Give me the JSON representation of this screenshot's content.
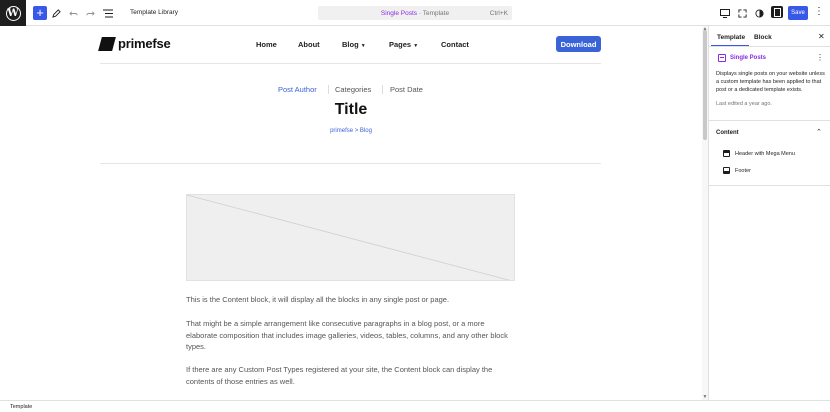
{
  "toolbar": {
    "add_label": "+",
    "document_overview_label": "Template Library",
    "command_center": {
      "title": "Single Posts",
      "suffix": " · Template",
      "shortcut": "Ctrl+K"
    },
    "save_label": "Save"
  },
  "site": {
    "logo_text": "primefse",
    "nav": [
      {
        "label": "Home"
      },
      {
        "label": "About"
      },
      {
        "label": "Blog",
        "has_dropdown": true
      },
      {
        "label": "Pages",
        "has_dropdown": true
      },
      {
        "label": "Contact"
      }
    ],
    "download_label": "Download"
  },
  "post": {
    "meta": {
      "author": "Post Author",
      "categories": "Categories",
      "date": "Post Date"
    },
    "title": "Title",
    "breadcrumb": "primefse > Blog",
    "paragraphs": [
      "This is the Content block, it will display all the blocks in any single post or page.",
      "That might be a simple arrangement like consecutive paragraphs in a blog post, or a more elaborate composition that includes image galleries, videos, tables, columns, and any other block types.",
      "If there are any Custom Post Types registered at your site, the Content block can display the contents of those entries as well."
    ]
  },
  "panel": {
    "tabs": [
      {
        "label": "Template",
        "active": true
      },
      {
        "label": "Block",
        "active": false
      }
    ],
    "template": {
      "name": "Single Posts",
      "description": "Displays single posts on your website unless a custom template has been applied to that post or a dedicated template exists.",
      "last_edited": "Last edited a year ago."
    },
    "content_heading": "Content",
    "areas": [
      {
        "label": "Header with Mega Menu",
        "icon": "header-icon"
      },
      {
        "label": "Footer",
        "icon": "footer-icon"
      }
    ]
  },
  "statusbar": {
    "label": "Template"
  },
  "colors": {
    "accent": "#3858e9",
    "template_purple": "#8a2be2",
    "download_blue": "#3a63d8"
  }
}
